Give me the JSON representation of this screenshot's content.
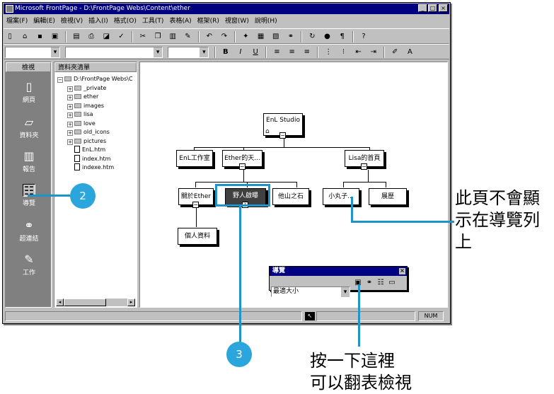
{
  "window": {
    "title": "Microsoft FrontPage - D:\\FrontPage Webs\\Content\\ether",
    "min": "_",
    "max": "□",
    "close": "×"
  },
  "menu": [
    "檔案(F)",
    "編輯(E)",
    "檢視(V)",
    "插入(I)",
    "格式(O)",
    "工具(T)",
    "表格(A)",
    "框架(R)",
    "視窗(W)",
    "說明(H)"
  ],
  "views_bar": {
    "title": "檢視",
    "items": [
      {
        "label": "網頁",
        "icon": "page-icon"
      },
      {
        "label": "資料夾",
        "icon": "folder-icon"
      },
      {
        "label": "報告",
        "icon": "reports-icon"
      },
      {
        "label": "導覽",
        "icon": "navigation-icon"
      },
      {
        "label": "超連結",
        "icon": "hyperlinks-icon"
      },
      {
        "label": "工作",
        "icon": "tasks-icon"
      }
    ]
  },
  "folder_list": {
    "title": "資料夾清單",
    "root": "D:\\FrontPage Webs\\C",
    "folders": [
      "_private",
      "ether",
      "images",
      "lisa",
      "love",
      "old_icons",
      "pictures"
    ],
    "files": [
      "EnL.htm",
      "index.htm",
      "indexe.htm"
    ]
  },
  "nav_tree": {
    "root": "EnL Studio",
    "level1": [
      "EnL工作室",
      "Ether的天...",
      "Lisa的首頁"
    ],
    "ether_children": [
      "關於Ether",
      "野人啟曝",
      "他山之石"
    ],
    "lisa_children": [
      "小丸子...",
      "展歷"
    ],
    "grandchild": "個人資料"
  },
  "nav_panel": {
    "title": "導覽",
    "zoom": "最適大小",
    "close": "×"
  },
  "status": {
    "num": "NUM"
  },
  "annotations": {
    "step2": "2",
    "step3": "3",
    "callout_right": [
      "此頁不會顯",
      "示在導覽列",
      "上"
    ],
    "callout_bottom": [
      "按一下這裡",
      "可以翻表檢視"
    ]
  },
  "colors": {
    "accent": "#2aa6dc",
    "titlebar": "#000080"
  }
}
